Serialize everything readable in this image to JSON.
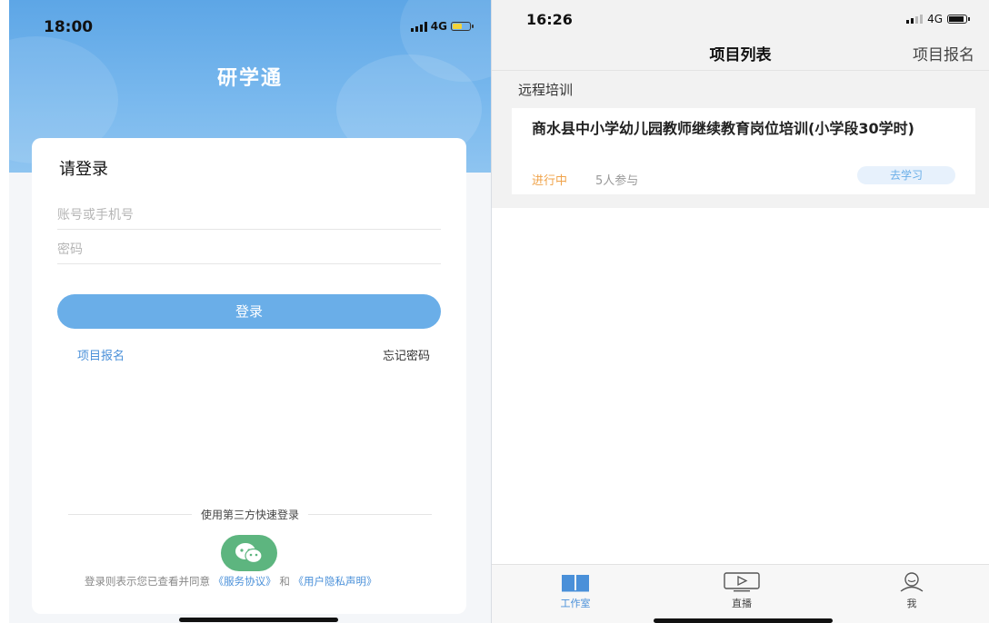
{
  "login_screen": {
    "status_bar": {
      "time": "18:00",
      "network": "4G"
    },
    "app_title": "研学通",
    "heading": "请登录",
    "account_field": {
      "placeholder": "账号或手机号"
    },
    "password_field": {
      "placeholder": "密码"
    },
    "login_button": "登录",
    "register_link": "项目报名",
    "forgot_link": "忘记密码",
    "third_party_label": "使用第三方快速登录",
    "agreement": {
      "prefix": "登录则表示您已查看并同意",
      "service_link": "《服务协议》",
      "and": "和",
      "privacy_link": "《用户隐私声明》"
    }
  },
  "project_screen": {
    "status_bar": {
      "time": "16:26",
      "network": "4G"
    },
    "nav": {
      "title": "项目列表",
      "right_action": "项目报名"
    },
    "section_title": "远程培训",
    "projects": [
      {
        "title": "商水县中小学幼儿园教师继续教育岗位培训(小学段30学时)",
        "status": "进行中",
        "participants": "5人参与",
        "action": "去学习"
      }
    ],
    "tabbar": [
      {
        "label": "工作室",
        "icon": "book-icon",
        "active": true
      },
      {
        "label": "直播",
        "icon": "tv-play-icon",
        "active": false
      },
      {
        "label": "我",
        "icon": "user-icon",
        "active": false
      }
    ]
  },
  "colors": {
    "primary": "#6aaee8",
    "link": "#4a90d9",
    "status_orange": "#f0a34a",
    "wechat_green": "#5db57f"
  }
}
